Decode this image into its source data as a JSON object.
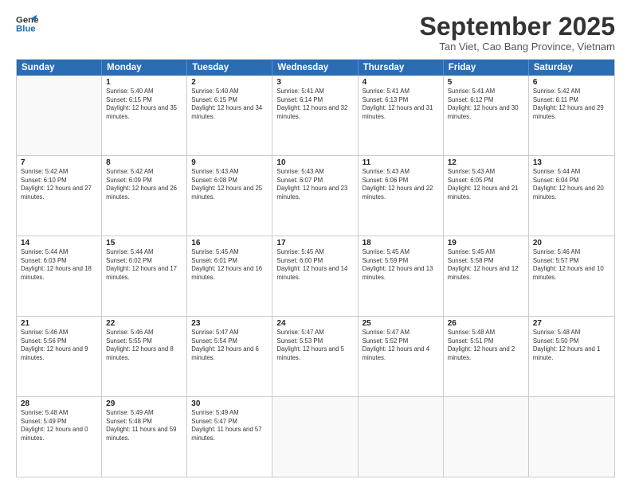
{
  "logo": {
    "line1": "General",
    "line2": "Blue"
  },
  "header": {
    "month": "September 2025",
    "location": "Tan Viet, Cao Bang Province, Vietnam"
  },
  "weekdays": [
    "Sunday",
    "Monday",
    "Tuesday",
    "Wednesday",
    "Thursday",
    "Friday",
    "Saturday"
  ],
  "rows": [
    [
      {
        "day": "",
        "empty": true
      },
      {
        "day": "1",
        "sunrise": "Sunrise: 5:40 AM",
        "sunset": "Sunset: 6:15 PM",
        "daylight": "Daylight: 12 hours and 35 minutes."
      },
      {
        "day": "2",
        "sunrise": "Sunrise: 5:40 AM",
        "sunset": "Sunset: 6:15 PM",
        "daylight": "Daylight: 12 hours and 34 minutes."
      },
      {
        "day": "3",
        "sunrise": "Sunrise: 5:41 AM",
        "sunset": "Sunset: 6:14 PM",
        "daylight": "Daylight: 12 hours and 32 minutes."
      },
      {
        "day": "4",
        "sunrise": "Sunrise: 5:41 AM",
        "sunset": "Sunset: 6:13 PM",
        "daylight": "Daylight: 12 hours and 31 minutes."
      },
      {
        "day": "5",
        "sunrise": "Sunrise: 5:41 AM",
        "sunset": "Sunset: 6:12 PM",
        "daylight": "Daylight: 12 hours and 30 minutes."
      },
      {
        "day": "6",
        "sunrise": "Sunrise: 5:42 AM",
        "sunset": "Sunset: 6:11 PM",
        "daylight": "Daylight: 12 hours and 29 minutes."
      }
    ],
    [
      {
        "day": "7",
        "sunrise": "Sunrise: 5:42 AM",
        "sunset": "Sunset: 6:10 PM",
        "daylight": "Daylight: 12 hours and 27 minutes."
      },
      {
        "day": "8",
        "sunrise": "Sunrise: 5:42 AM",
        "sunset": "Sunset: 6:09 PM",
        "daylight": "Daylight: 12 hours and 26 minutes."
      },
      {
        "day": "9",
        "sunrise": "Sunrise: 5:43 AM",
        "sunset": "Sunset: 6:08 PM",
        "daylight": "Daylight: 12 hours and 25 minutes."
      },
      {
        "day": "10",
        "sunrise": "Sunrise: 5:43 AM",
        "sunset": "Sunset: 6:07 PM",
        "daylight": "Daylight: 12 hours and 23 minutes."
      },
      {
        "day": "11",
        "sunrise": "Sunrise: 5:43 AM",
        "sunset": "Sunset: 6:06 PM",
        "daylight": "Daylight: 12 hours and 22 minutes."
      },
      {
        "day": "12",
        "sunrise": "Sunrise: 5:43 AM",
        "sunset": "Sunset: 6:05 PM",
        "daylight": "Daylight: 12 hours and 21 minutes."
      },
      {
        "day": "13",
        "sunrise": "Sunrise: 5:44 AM",
        "sunset": "Sunset: 6:04 PM",
        "daylight": "Daylight: 12 hours and 20 minutes."
      }
    ],
    [
      {
        "day": "14",
        "sunrise": "Sunrise: 5:44 AM",
        "sunset": "Sunset: 6:03 PM",
        "daylight": "Daylight: 12 hours and 18 minutes."
      },
      {
        "day": "15",
        "sunrise": "Sunrise: 5:44 AM",
        "sunset": "Sunset: 6:02 PM",
        "daylight": "Daylight: 12 hours and 17 minutes."
      },
      {
        "day": "16",
        "sunrise": "Sunrise: 5:45 AM",
        "sunset": "Sunset: 6:01 PM",
        "daylight": "Daylight: 12 hours and 16 minutes."
      },
      {
        "day": "17",
        "sunrise": "Sunrise: 5:45 AM",
        "sunset": "Sunset: 6:00 PM",
        "daylight": "Daylight: 12 hours and 14 minutes."
      },
      {
        "day": "18",
        "sunrise": "Sunrise: 5:45 AM",
        "sunset": "Sunset: 5:59 PM",
        "daylight": "Daylight: 12 hours and 13 minutes."
      },
      {
        "day": "19",
        "sunrise": "Sunrise: 5:45 AM",
        "sunset": "Sunset: 5:58 PM",
        "daylight": "Daylight: 12 hours and 12 minutes."
      },
      {
        "day": "20",
        "sunrise": "Sunrise: 5:46 AM",
        "sunset": "Sunset: 5:57 PM",
        "daylight": "Daylight: 12 hours and 10 minutes."
      }
    ],
    [
      {
        "day": "21",
        "sunrise": "Sunrise: 5:46 AM",
        "sunset": "Sunset: 5:56 PM",
        "daylight": "Daylight: 12 hours and 9 minutes."
      },
      {
        "day": "22",
        "sunrise": "Sunrise: 5:46 AM",
        "sunset": "Sunset: 5:55 PM",
        "daylight": "Daylight: 12 hours and 8 minutes."
      },
      {
        "day": "23",
        "sunrise": "Sunrise: 5:47 AM",
        "sunset": "Sunset: 5:54 PM",
        "daylight": "Daylight: 12 hours and 6 minutes."
      },
      {
        "day": "24",
        "sunrise": "Sunrise: 5:47 AM",
        "sunset": "Sunset: 5:53 PM",
        "daylight": "Daylight: 12 hours and 5 minutes."
      },
      {
        "day": "25",
        "sunrise": "Sunrise: 5:47 AM",
        "sunset": "Sunset: 5:52 PM",
        "daylight": "Daylight: 12 hours and 4 minutes."
      },
      {
        "day": "26",
        "sunrise": "Sunrise: 5:48 AM",
        "sunset": "Sunset: 5:51 PM",
        "daylight": "Daylight: 12 hours and 2 minutes."
      },
      {
        "day": "27",
        "sunrise": "Sunrise: 5:48 AM",
        "sunset": "Sunset: 5:50 PM",
        "daylight": "Daylight: 12 hours and 1 minute."
      }
    ],
    [
      {
        "day": "28",
        "sunrise": "Sunrise: 5:48 AM",
        "sunset": "Sunset: 5:49 PM",
        "daylight": "Daylight: 12 hours and 0 minutes."
      },
      {
        "day": "29",
        "sunrise": "Sunrise: 5:49 AM",
        "sunset": "Sunset: 5:48 PM",
        "daylight": "Daylight: 11 hours and 59 minutes."
      },
      {
        "day": "30",
        "sunrise": "Sunrise: 5:49 AM",
        "sunset": "Sunset: 5:47 PM",
        "daylight": "Daylight: 11 hours and 57 minutes."
      },
      {
        "day": "",
        "empty": true
      },
      {
        "day": "",
        "empty": true
      },
      {
        "day": "",
        "empty": true
      },
      {
        "day": "",
        "empty": true
      }
    ]
  ]
}
